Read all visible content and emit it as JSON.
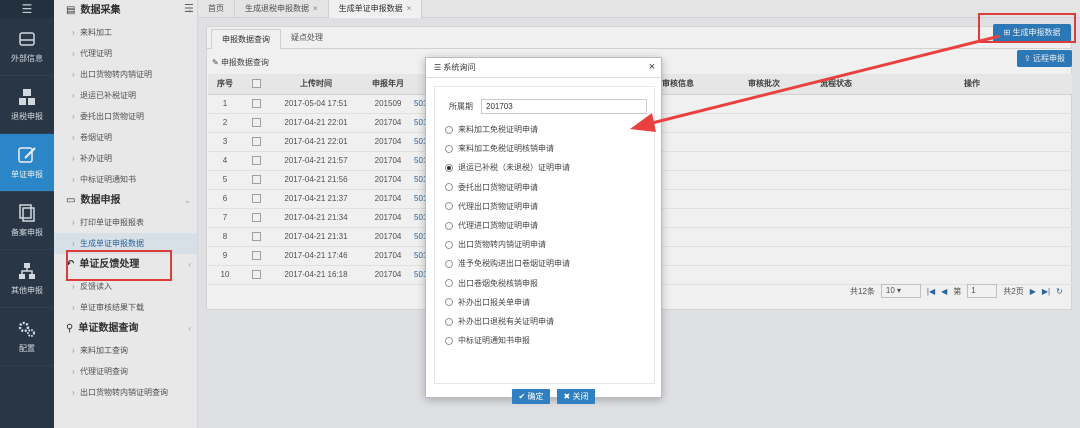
{
  "nav": {
    "menu_icon": "hamburger-icon",
    "items": [
      {
        "label": "外部信息",
        "icon": "drive-icon"
      },
      {
        "label": "退税申报",
        "icon": "cubes-icon"
      },
      {
        "label": "单证申报",
        "icon": "edit-icon",
        "active": true
      },
      {
        "label": "备案申报",
        "icon": "copy-icon"
      },
      {
        "label": "其他申报",
        "icon": "tree-icon"
      },
      {
        "label": "配置",
        "icon": "gears-icon"
      }
    ]
  },
  "sidebar": {
    "sections": [
      {
        "title": "数据采集",
        "icon": "file-icon",
        "items": [
          "来料加工",
          "代理证明",
          "出口货物转内销证明",
          "退运已补税证明",
          "委托出口货物证明",
          "卷烟证明",
          "补办证明",
          "中标证明通知书"
        ]
      },
      {
        "title": "数据申报",
        "icon": "monitor-icon",
        "items": [
          "打印单证申报报表",
          "生成单证申报数据"
        ]
      },
      {
        "title": "单证反馈处理",
        "icon": "reply-icon",
        "items": [
          "反馈读入",
          "单证审核结果下载"
        ]
      },
      {
        "title": "单证数据查询",
        "icon": "search-icon",
        "items": [
          "来料加工查询",
          "代理证明查询",
          "出口货物转内销证明查询"
        ]
      }
    ]
  },
  "topbar": {
    "tabs": [
      "首页",
      "生成退税申报数据",
      "生成单证申报数据"
    ]
  },
  "panel": {
    "tabs": [
      "申报数据查询",
      "疑点处理"
    ],
    "query_title": "申报数据查询",
    "gen_button": "生成申报数据",
    "remote_button": "远程申报",
    "columns": [
      "序号",
      "",
      "上传时间",
      "申报年月",
      "",
      "审核信息",
      "审核批次",
      "流程状态",
      "操作"
    ],
    "rows": [
      {
        "no": "1",
        "time": "2017-05-04 17:51",
        "ym": "201509",
        "code": "501"
      },
      {
        "no": "2",
        "time": "2017-04-21 22:01",
        "ym": "201704",
        "code": "501"
      },
      {
        "no": "3",
        "time": "2017-04-21 22:01",
        "ym": "201704",
        "code": "501"
      },
      {
        "no": "4",
        "time": "2017-04-21 21:57",
        "ym": "201704",
        "code": "501"
      },
      {
        "no": "5",
        "time": "2017-04-21 21:56",
        "ym": "201704",
        "code": "501"
      },
      {
        "no": "6",
        "time": "2017-04-21 21:37",
        "ym": "201704",
        "code": "501"
      },
      {
        "no": "7",
        "time": "2017-04-21 21:34",
        "ym": "201704",
        "code": "501"
      },
      {
        "no": "8",
        "time": "2017-04-21 21:31",
        "ym": "201704",
        "code": "501"
      },
      {
        "no": "9",
        "time": "2017-04-21 17:46",
        "ym": "201704",
        "code": "501"
      },
      {
        "no": "10",
        "time": "2017-04-21 16:18",
        "ym": "201704",
        "code": "501"
      }
    ],
    "pager": {
      "total": "共12条",
      "page_size": "10",
      "page_label": "第",
      "page": "1",
      "total_pages": "共2页"
    }
  },
  "dialog": {
    "title": "系统询问",
    "period_label": "所属期",
    "period_value": "201703",
    "options": [
      "来料加工免税证明申请",
      "来料加工免税证明核销申请",
      "退运已补税（未退税）证明申请",
      "委托出口货物证明申请",
      "代理出口货物证明申请",
      "代理进口货物证明申请",
      "出口货物转内销证明申请",
      "准予免税购进出口卷烟证明申请",
      "出口卷烟免税核销申报",
      "补办出口报关单申请",
      "补办出口退税有关证明申请",
      "中标证明通知书申报"
    ],
    "selected_index": 2,
    "ok_label": "确定",
    "close_label": "关闭"
  },
  "colors": {
    "accent": "#2f7fc1",
    "highlight": "#e8413e",
    "nav_bg": "#2b3a4a",
    "nav_active": "#2d8fd3"
  }
}
